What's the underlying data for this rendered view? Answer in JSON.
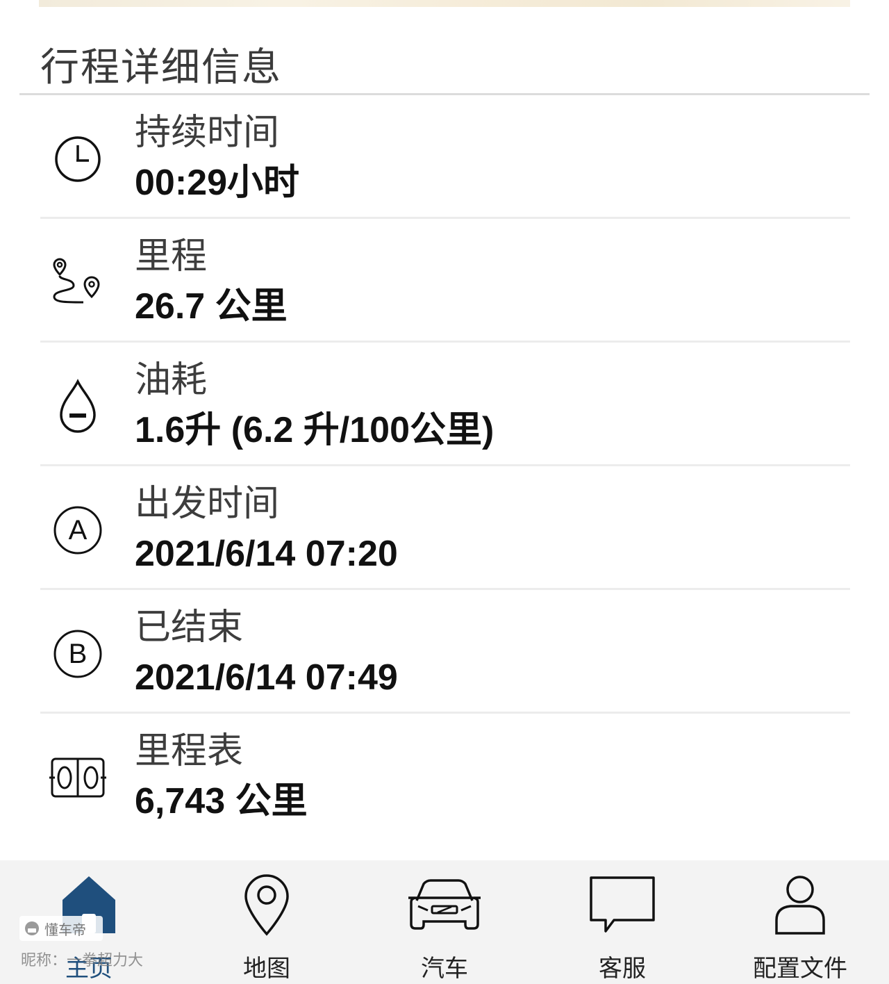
{
  "section": {
    "title": "行程详细信息"
  },
  "rows": [
    {
      "icon": "clock-icon",
      "label": "持续时间",
      "value": "00:29小时"
    },
    {
      "icon": "route-icon",
      "label": "里程",
      "value": "26.7 公里"
    },
    {
      "icon": "fuel-drop-icon",
      "label": "油耗",
      "value": "1.6升 (6.2 升/100公里)"
    },
    {
      "icon": "start-point-a-icon",
      "label": "出发时间",
      "value": "2021/6/14 07:20"
    },
    {
      "icon": "end-point-b-icon",
      "label": "已结束",
      "value": "2021/6/14 07:49"
    },
    {
      "icon": "odometer-icon",
      "label": "里程表",
      "value": "6,743 公里"
    }
  ],
  "tabbar": {
    "active": "主页",
    "items": [
      {
        "icon": "home-icon",
        "label": "主页"
      },
      {
        "icon": "map-pin-icon",
        "label": "地图"
      },
      {
        "icon": "car-icon",
        "label": "汽车"
      },
      {
        "icon": "chat-bubble-icon",
        "label": "客服"
      },
      {
        "icon": "profile-icon",
        "label": "配置文件"
      }
    ]
  },
  "watermark": {
    "brand": "懂车帝",
    "nickname": "昵称：一拳超力大"
  },
  "colors": {
    "accent": "#1f4f7d",
    "label": "#3d3d3d",
    "value": "#111111",
    "tabbar_bg": "#f3f3f3"
  }
}
